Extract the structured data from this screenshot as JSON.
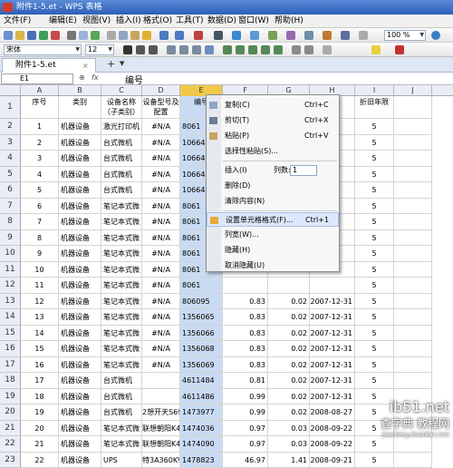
{
  "window": {
    "title": "附件1-5.et - WPS 表格"
  },
  "menu": [
    "文件(F)",
    "编辑(E)",
    "视图(V)",
    "插入(I)",
    "格式(O)",
    "工具(T)",
    "数据(D)",
    "窗口(W)",
    "帮助(H)"
  ],
  "toolbar": {
    "zoom": "100 %",
    "font": "宋体",
    "font_size": "12"
  },
  "tab": {
    "name": "附件1-5.et",
    "add": "+"
  },
  "formula": {
    "cell_ref": "E1",
    "fx": "fx",
    "content": "编号"
  },
  "columns": [
    "A",
    "B",
    "C",
    "D",
    "E",
    "F",
    "G",
    "H",
    "I",
    "J"
  ],
  "header_row": [
    "序号",
    "类别",
    "设备名称（子类别）",
    "设备型号及配置",
    "编号",
    "",
    "",
    "间",
    "折旧年限",
    ""
  ],
  "rows": [
    [
      "1",
      "机器设备",
      "激光打印机",
      "#N/A",
      "8061",
      "",
      "",
      "",
      "5",
      ""
    ],
    [
      "2",
      "机器设备",
      "台式微机",
      "#N/A",
      "10664",
      "",
      "",
      "",
      "5",
      ""
    ],
    [
      "3",
      "机器设备",
      "台式微机",
      "#N/A",
      "10664",
      "",
      "",
      "",
      "5",
      ""
    ],
    [
      "4",
      "机器设备",
      "台式微机",
      "#N/A",
      "10664",
      "",
      "",
      "",
      "5",
      ""
    ],
    [
      "5",
      "机器设备",
      "台式微机",
      "#N/A",
      "10664",
      "",
      "",
      "",
      "5",
      ""
    ],
    [
      "6",
      "机器设备",
      "笔记本式微",
      "#N/A",
      "8061",
      "",
      "",
      "",
      "5",
      ""
    ],
    [
      "7",
      "机器设备",
      "笔记本式微",
      "#N/A",
      "8061",
      "",
      "",
      "",
      "5",
      ""
    ],
    [
      "8",
      "机器设备",
      "笔记本式微",
      "#N/A",
      "8061",
      "",
      "",
      "",
      "5",
      ""
    ],
    [
      "9",
      "机器设备",
      "笔记本式微",
      "#N/A",
      "8061",
      "",
      "",
      "",
      "5",
      ""
    ],
    [
      "10",
      "机器设备",
      "笔记本式微",
      "#N/A",
      "8061",
      "",
      "",
      "",
      "5",
      ""
    ],
    [
      "11",
      "机器设备",
      "笔记本式微",
      "#N/A",
      "8061",
      "",
      "",
      "",
      "5",
      ""
    ],
    [
      "12",
      "机器设备",
      "笔记本式微",
      "#N/A",
      "806095",
      "0.83",
      "0.02",
      "2007-12-31",
      "5",
      ""
    ],
    [
      "13",
      "机器设备",
      "笔记本式微",
      "#N/A",
      "1356065",
      "0.83",
      "0.02",
      "2007-12-31",
      "5",
      ""
    ],
    [
      "14",
      "机器设备",
      "笔记本式微",
      "#N/A",
      "1356066",
      "0.83",
      "0.02",
      "2007-12-31",
      "5",
      ""
    ],
    [
      "15",
      "机器设备",
      "笔记本式微",
      "#N/A",
      "1356068",
      "0.83",
      "0.02",
      "2007-12-31",
      "5",
      ""
    ],
    [
      "16",
      "机器设备",
      "笔记本式微",
      "#N/A",
      "1356069",
      "0.83",
      "0.02",
      "2007-12-31",
      "5",
      ""
    ],
    [
      "17",
      "机器设备",
      "台式微机",
      "",
      "4611484",
      "0.81",
      "0.02",
      "2007-12-31",
      "5",
      ""
    ],
    [
      "18",
      "机器设备",
      "台式微机",
      "",
      "4611486",
      "0.99",
      "0.02",
      "2007-12-31",
      "5",
      ""
    ],
    [
      "19",
      "机器设备",
      "台式微机",
      "2想开天S69",
      "1473977",
      "0.99",
      "0.02",
      "2008-08-27",
      "5",
      ""
    ],
    [
      "20",
      "机器设备",
      "笔记本式微",
      "联想朝阳K4",
      "1474036",
      "0.97",
      "0.03",
      "2008-09-22",
      "5",
      ""
    ],
    [
      "21",
      "机器设备",
      "笔记本式微",
      "联想朝阳K4",
      "1474090",
      "0.97",
      "0.03",
      "2008-09-22",
      "5",
      ""
    ],
    [
      "22",
      "机器设备",
      "UPS",
      "特3A360KV",
      "1478823",
      "46.97",
      "1.41",
      "2008-09-21",
      "5",
      ""
    ]
  ],
  "context_menu": {
    "items": [
      {
        "label": "复制(C)",
        "shortcut": "Ctrl+C",
        "icon": "copy-icon"
      },
      {
        "label": "剪切(T)",
        "shortcut": "Ctrl+X",
        "icon": "cut-icon"
      },
      {
        "label": "粘贴(P)",
        "shortcut": "Ctrl+V",
        "icon": "paste-icon"
      },
      {
        "label": "选择性粘贴(S)...",
        "shortcut": "",
        "icon": ""
      },
      {
        "label": "插入(I)",
        "shortcut": "",
        "icon": "",
        "extra_label": "列数:",
        "extra_value": "1"
      },
      {
        "label": "删除(D)",
        "shortcut": "",
        "icon": ""
      },
      {
        "label": "清除内容(N)",
        "shortcut": "",
        "icon": ""
      },
      {
        "label": "设置单元格格式(F)...",
        "shortcut": "Ctrl+1",
        "icon": "format-cells-icon"
      },
      {
        "label": "列宽(W)...",
        "shortcut": "",
        "icon": ""
      },
      {
        "label": "隐藏(H)",
        "shortcut": "",
        "icon": ""
      },
      {
        "label": "取消隐藏(U)",
        "shortcut": "",
        "icon": ""
      }
    ]
  },
  "watermark": {
    "line1": "ib51.net",
    "line2": "查字典 教程网",
    "line3": "jiaocheng.chazidian.com"
  },
  "colors": {
    "title_bar": "#2c5fb8",
    "selection": "#c9dbf2",
    "menu_highlight": "#dce8fb"
  }
}
